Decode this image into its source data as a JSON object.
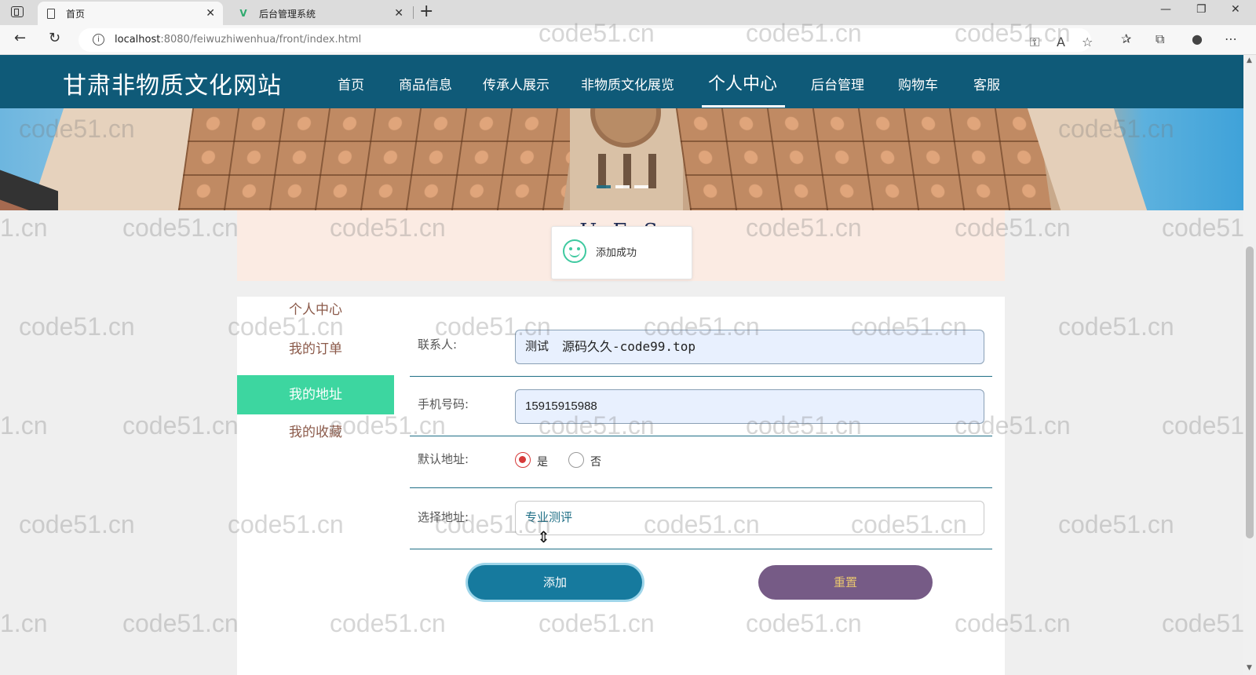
{
  "browser": {
    "tabs": [
      {
        "title": "首页",
        "active": true
      },
      {
        "title": "后台管理系统",
        "active": false
      }
    ],
    "new_tab_symbol": "+",
    "close_symbol": "✕",
    "window_controls": [
      "—",
      "❐",
      "✕"
    ],
    "url_host": "localhost",
    "url_rest": ":8080/feiwuzhiwenhua/front/index.html"
  },
  "site": {
    "title": "甘肃非物质文化网站",
    "nav": [
      {
        "label": "首页"
      },
      {
        "label": "商品信息"
      },
      {
        "label": "传承人展示"
      },
      {
        "label": "非物质文化展览"
      },
      {
        "label": "个人中心",
        "active": true
      },
      {
        "label": "后台管理"
      },
      {
        "label": "购物车"
      },
      {
        "label": "客服"
      }
    ]
  },
  "section": {
    "heading": "U       E    S"
  },
  "toast": {
    "message": "添加成功",
    "icon": "smiley-icon"
  },
  "sidebar": {
    "items": [
      {
        "label": "个人中心"
      },
      {
        "label": "我的订单"
      },
      {
        "label": "我的地址",
        "active": true
      },
      {
        "label": "我的收藏"
      }
    ]
  },
  "form": {
    "contact": {
      "label": "联系人:",
      "value": "测试"
    },
    "phone": {
      "label": "手机号码:",
      "value": "15915915988"
    },
    "default_address": {
      "label": "默认地址:",
      "options": [
        {
          "label": "是",
          "checked": true
        },
        {
          "label": "否",
          "checked": false
        }
      ]
    },
    "address": {
      "label": "选择地址:",
      "value": "专业测评"
    },
    "add_button": "添加",
    "reset_button": "重置"
  },
  "overlay_text": "源码久久-code99.top",
  "watermark": "code51.cn",
  "watermark_partials": [
    "1.cn",
    "code51"
  ],
  "colors": {
    "header_bg": "#0f5a78",
    "sidebar_active": "#3dd6a0",
    "add_button": "#167a9e",
    "reset_button": "#765b86",
    "heading_band": "#fbebe3"
  }
}
